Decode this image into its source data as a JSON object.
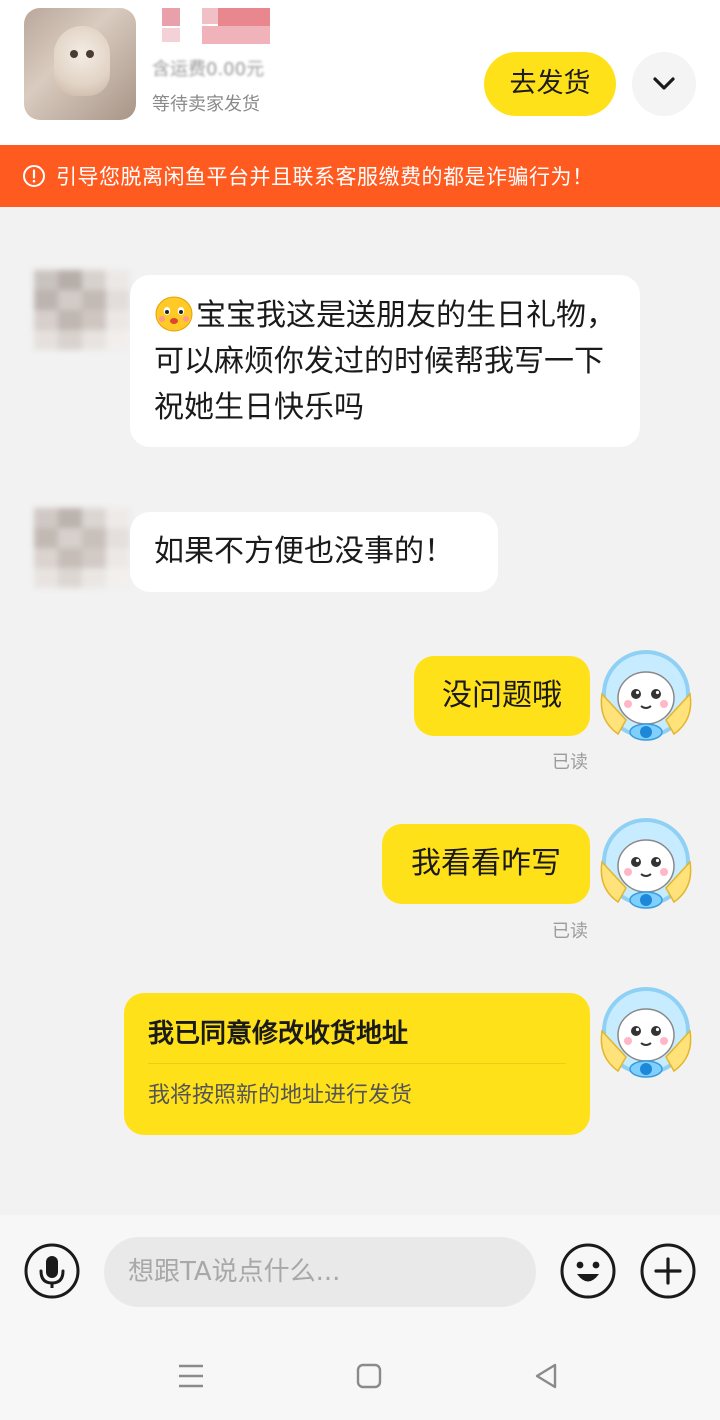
{
  "order": {
    "shipping_fee": "含运费0.00元",
    "status": "等待卖家发货",
    "ship_button": "去发货",
    "expand_icon": "chevron-down-icon"
  },
  "warning": {
    "icon": "alert-circle-icon",
    "text": "引导您脱离闲鱼平台并且联系客服缴费的都是诈骗行为！"
  },
  "messages": {
    "m1": {
      "emoji": "blushing-face-emoji",
      "text": "宝宝我这是送朋友的生日礼物，可以麻烦你发过的时候帮我写一下祝她生日快乐吗"
    },
    "m2": {
      "text": "如果不方便也没事的！"
    },
    "m3": {
      "text": "没问题哦",
      "read": "已读"
    },
    "m4": {
      "text": "我看看咋写",
      "read": "已读"
    },
    "card": {
      "title": "我已同意修改收货地址",
      "subtitle": "我将按照新的地址进行发货"
    }
  },
  "input_bar": {
    "voice_icon": "microphone-icon",
    "placeholder": "想跟TA说点什么...",
    "emoji_icon": "smiley-icon",
    "more_icon": "plus-icon"
  },
  "nav": {
    "menu_icon": "menu-icon",
    "home_icon": "home-square-icon",
    "back_icon": "back-triangle-icon"
  },
  "colors": {
    "accent_yellow": "#ffe11a",
    "warning_orange": "#ff5a1f",
    "chat_background": "#f2f2f2"
  }
}
